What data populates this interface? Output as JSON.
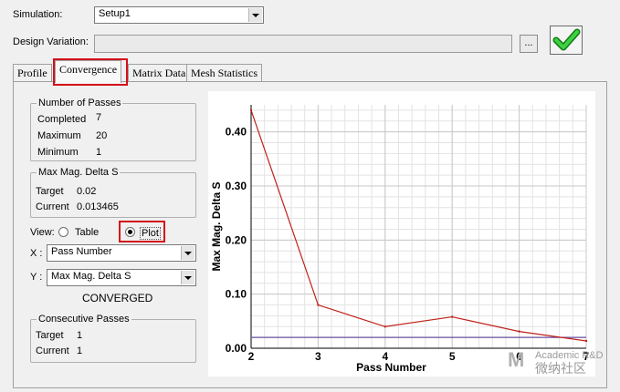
{
  "simulation": {
    "label": "Simulation:",
    "value": "Setup1"
  },
  "design_variation": {
    "label": "Design Variation:",
    "value": "",
    "browse_label": "..."
  },
  "tabs": [
    {
      "label": "Profile",
      "active": false
    },
    {
      "label": "Convergence",
      "active": true
    },
    {
      "label": "Matrix Data",
      "active": false
    },
    {
      "label": "Mesh Statistics",
      "active": false
    }
  ],
  "passes": {
    "title": "Number of Passes",
    "completed_label": "Completed",
    "completed": "7",
    "maximum_label": "Maximum",
    "maximum": "20",
    "minimum_label": "Minimum",
    "minimum": "1"
  },
  "delta": {
    "title": "Max Mag. Delta S",
    "target_label": "Target",
    "target": "0.02",
    "current_label": "Current",
    "current": "0.013465"
  },
  "view": {
    "label": "View:",
    "table_label": "Table",
    "plot_label": "Plot",
    "selected": "Plot"
  },
  "x_select": {
    "label": "X :",
    "value": "Pass Number"
  },
  "y_select": {
    "label": "Y :",
    "value": "Max Mag. Delta S"
  },
  "status": "CONVERGED",
  "consecutive": {
    "title": "Consecutive Passes",
    "target_label": "Target",
    "target": "1",
    "current_label": "Current",
    "current": "1"
  },
  "watermark": {
    "line1": "Academic R&D",
    "line2": "微纳社区"
  },
  "colors": {
    "series": "#c0211b",
    "target_line": "#6a4f9c",
    "highlight": "#d4111a",
    "check": "#22b32a"
  },
  "chart_data": {
    "type": "line",
    "xlabel": "Pass Number",
    "ylabel": "Max Mag. Delta S",
    "xlim": [
      2,
      7
    ],
    "ylim": [
      0,
      0.45
    ],
    "x_ticks": [
      "2",
      "3",
      "4",
      "5",
      "6",
      "7"
    ],
    "y_ticks": [
      "0.00",
      "0.10",
      "0.20",
      "0.30",
      "0.40"
    ],
    "grid": true,
    "series": [
      {
        "x": [
          2,
          3,
          4,
          5,
          6,
          7
        ],
        "values": [
          0.44,
          0.08,
          0.04,
          0.058,
          0.031,
          0.013465
        ]
      }
    ],
    "target_line": 0.02
  }
}
